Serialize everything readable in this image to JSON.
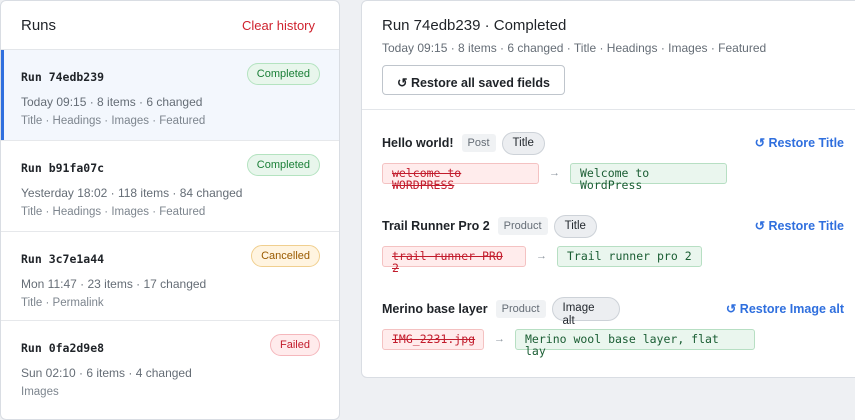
{
  "runs_panel": {
    "title": "Runs",
    "clear_label": "Clear history",
    "runs": [
      {
        "name": "Run 74edb239",
        "status": "Completed",
        "meta": "Today 09:15 · 8 items · 6 changed",
        "fields": "Title · Headings · Images · Featured"
      },
      {
        "name": "Run b91fa07c",
        "status": "Completed",
        "meta": "Yesterday 18:02 · 118 items · 84 changed",
        "fields": "Title · Headings · Images · Featured"
      },
      {
        "name": "Run 3c7e1a44",
        "status": "Cancelled",
        "meta": "Mon 11:47 · 23 items · 17 changed",
        "fields": "Title · Permalink"
      },
      {
        "name": "Run 0fa2d9e8",
        "status": "Failed",
        "meta": "Sun 02:10 · 6 items · 4 changed",
        "fields": "Images"
      }
    ]
  },
  "detail": {
    "title": "Run 74edb239 · Completed",
    "meta": "Today 09:15 · 8 items · 6 changed · Title · Headings · Images · Featured",
    "restore_all_label": "↺ Restore all saved fields",
    "items": [
      {
        "name": "Hello world!",
        "type": "Post",
        "field": "Title",
        "restore_label": "↺ Restore Title",
        "old": "welcome to WORDPRESS",
        "new": "Welcome to WordPress"
      },
      {
        "name": "Trail Runner Pro 2",
        "type": "Product",
        "field": "Title",
        "restore_label": "↺ Restore Title",
        "old": "trail runner PRO 2",
        "new": "Trail runner pro 2"
      },
      {
        "name": "Merino base layer",
        "type": "Product",
        "field": "Image alt",
        "restore_label": "↺ Restore Image alt",
        "old": "IMG_2231.jpg",
        "new": "Merino wool base layer, flat lay"
      }
    ],
    "arrow": "→"
  }
}
